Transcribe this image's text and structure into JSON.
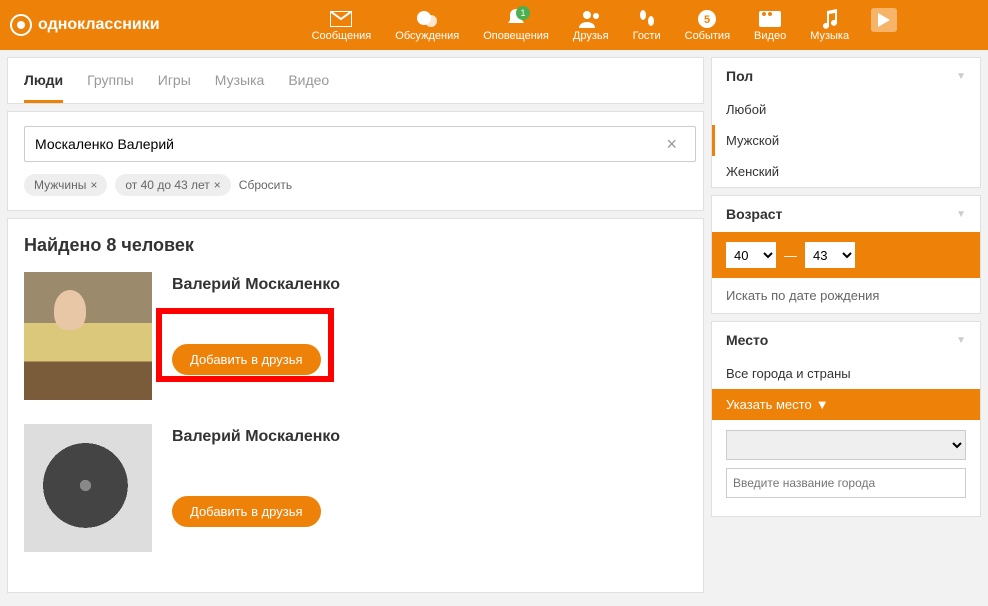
{
  "brand": "одноклассники",
  "nav": {
    "messages": "Сообщения",
    "discussions": "Обсуждения",
    "notifications": "Оповещения",
    "notif_badge": "1",
    "friends": "Друзья",
    "guests": "Гости",
    "events": "События",
    "events_badge": "5",
    "video": "Видео",
    "music": "Музыка"
  },
  "tabs": {
    "people": "Люди",
    "groups": "Группы",
    "games": "Игры",
    "music": "Музыка",
    "video": "Видео"
  },
  "search": {
    "value": "Москаленко Валерий",
    "chip_gender": "Мужчины",
    "chip_age": "от 40 до 43 лет",
    "reset": "Сбросить"
  },
  "results": {
    "heading": "Найдено 8 человек",
    "items": [
      {
        "name": "Валерий Москаленко",
        "add": "Добавить в друзья"
      },
      {
        "name": "Валерий Москаленко",
        "add": "Добавить в друзья"
      }
    ]
  },
  "filters": {
    "gender": {
      "title": "Пол",
      "any": "Любой",
      "male": "Мужской",
      "female": "Женский"
    },
    "age": {
      "title": "Возраст",
      "from": "40",
      "to": "43",
      "birth": "Искать по дате рождения"
    },
    "place": {
      "title": "Место",
      "all": "Все города и страны",
      "choose": "Указать место",
      "city_placeholder": "Введите название города"
    }
  }
}
